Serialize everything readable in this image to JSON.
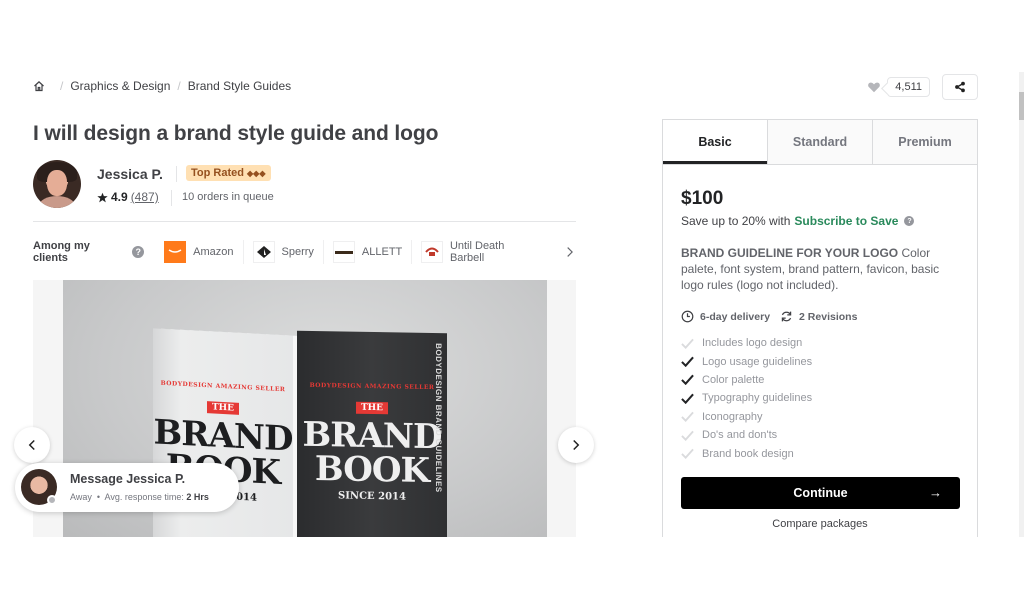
{
  "breadcrumb": {
    "home_icon": "home-icon",
    "items": [
      "Graphics & Design",
      "Brand Style Guides"
    ],
    "separator": "/"
  },
  "actions": {
    "like_icon": "heart-icon",
    "like_count": "4,511",
    "share_icon": "share-icon"
  },
  "gig": {
    "title": "I will design a brand style guide and logo"
  },
  "seller": {
    "name": "Jessica P.",
    "badge": "Top Rated",
    "badge_icon": "◆◆◆",
    "rating": "4.9",
    "reviews": "(487)",
    "orders_in_queue": "10 orders in queue"
  },
  "clients": {
    "label": "Among my clients",
    "help": "?",
    "items": [
      {
        "name": "Amazon",
        "logo": "amazon-logo"
      },
      {
        "name": "Sperry",
        "logo": "sperry-logo"
      },
      {
        "name": "ALLETT",
        "logo": "allett-logo"
      },
      {
        "name": "Until Death Barbell",
        "logo": "until-death-barbell-logo"
      }
    ]
  },
  "gallery": {
    "image_alt": "Brand book mockup",
    "book_arc_text": "BODYDESIGN AMAZING SELLER",
    "book_the": "THE",
    "book_brand": "BRAND",
    "book_book": "BOOK",
    "book_since": "SINCE 2014",
    "book_spine": "BODYDESIGN BRAND GUIDELINES"
  },
  "message": {
    "title": "Message Jessica P.",
    "status": "Away",
    "response_label": "Avg. response time:",
    "response_value": "2 Hrs"
  },
  "package": {
    "tabs": [
      {
        "label": "Basic",
        "active": true
      },
      {
        "label": "Standard",
        "active": false
      },
      {
        "label": "Premium",
        "active": false
      }
    ],
    "price": "$100",
    "save_text": "Save up to 20% with",
    "save_link": "Subscribe to Save",
    "description_title": "BRAND GUIDELINE FOR YOUR LOGO",
    "description_body": "Color palete, font system, brand pattern, favicon, basic logo rules (logo not included).",
    "delivery": "6-day delivery",
    "revisions": "2 Revisions",
    "features": [
      {
        "label": "Includes logo design",
        "included": false
      },
      {
        "label": "Logo usage guidelines",
        "included": true
      },
      {
        "label": "Color palette",
        "included": true
      },
      {
        "label": "Typography guidelines",
        "included": true
      },
      {
        "label": "Iconography",
        "included": false
      },
      {
        "label": "Do's and don'ts",
        "included": false
      },
      {
        "label": "Brand book design",
        "included": false
      }
    ],
    "continue_label": "Continue",
    "continue_arrow": "→",
    "compare_label": "Compare packages"
  },
  "colors": {
    "accent_green": "#2a8a5c",
    "badge_bg": "#ffe0b3",
    "badge_text": "#95501f",
    "primary_button": "#000000"
  }
}
